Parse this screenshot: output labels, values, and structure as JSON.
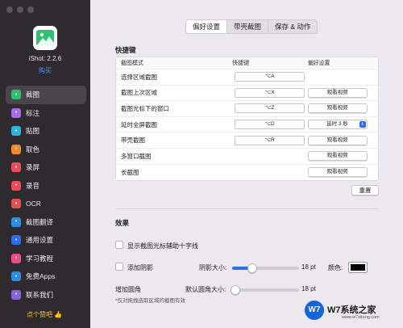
{
  "sidebar": {
    "app_name": "iShot: 2.2.6",
    "buy_label": "购买",
    "like_label": "点个赞吧 👍",
    "items": [
      {
        "label": "截图",
        "icon": "screenshot-icon",
        "color": "#2fbf71",
        "active": true
      },
      {
        "label": "标注",
        "icon": "annotate-icon",
        "color": "#a66cf0"
      },
      {
        "label": "贴图",
        "icon": "pin-icon",
        "color": "#2bb3d8"
      },
      {
        "label": "取色",
        "icon": "color-picker-icon",
        "color": "#f08a2a"
      },
      {
        "label": "录屏",
        "icon": "screen-record-icon",
        "color": "#ee4a5c"
      },
      {
        "label": "录音",
        "icon": "audio-record-icon",
        "color": "#ee4a5c"
      },
      {
        "label": "OCR",
        "icon": "ocr-icon",
        "color": "#e05252"
      },
      {
        "label": "截图翻译",
        "icon": "translate-icon",
        "color": "#2f8de8"
      },
      {
        "label": "通用设置",
        "icon": "gear-icon",
        "color": "#2f6df0"
      },
      {
        "label": "学习教程",
        "icon": "tutorial-icon",
        "color": "#ee4a8c"
      },
      {
        "label": "免费Apps",
        "icon": "app-store-icon",
        "color": "#2f8de8"
      },
      {
        "label": "联系我们",
        "icon": "contact-icon",
        "color": "#8a64e0"
      }
    ]
  },
  "tabs": [
    "偏好设置",
    "带壳截图",
    "保存 & 动作"
  ],
  "shortcuts": {
    "section_title": "快捷键",
    "headers": [
      "截图模式",
      "快捷键",
      "偏好设置"
    ],
    "rows": [
      {
        "mode": "选择区域截图",
        "hotkey": "⌥A",
        "pref": ""
      },
      {
        "mode": "截图上次区域",
        "hotkey": "⌥X",
        "pref": "观看视频"
      },
      {
        "mode": "截图光标下的窗口",
        "hotkey": "⌥Z",
        "pref": "观看视频"
      },
      {
        "mode": "延时全屏截图",
        "hotkey": "⌥D",
        "pref": "延时 3 秒",
        "pref_type": "select"
      },
      {
        "mode": "带壳截图",
        "hotkey": "⌥R",
        "pref": "观看视频"
      },
      {
        "mode": "多窗口截图",
        "hotkey": "",
        "pref": "观看视频"
      },
      {
        "mode": "长截图",
        "hotkey": "",
        "pref": "观看视频"
      }
    ],
    "reset_label": "重置"
  },
  "effects": {
    "section_title": "效果",
    "crosshair_label": "显示截图光标辅助十字线",
    "shadow_label": "添加阴影",
    "shadow_size_label": "阴影大小:",
    "shadow_size_value": "18 pt",
    "shadow_size_level": 0.3,
    "color_label": "颜色:",
    "shadow_color": "#000000",
    "round_label": "增加圆角",
    "round_size_label": "默认圆角大小:",
    "round_size_value": "18 pt",
    "round_size_level": 0.05,
    "note": "*仅对拖拽选取区域的截图有效"
  },
  "watermark": {
    "logo": "W7",
    "text": "W7系统之家",
    "url": "www.w7xitong.com"
  }
}
